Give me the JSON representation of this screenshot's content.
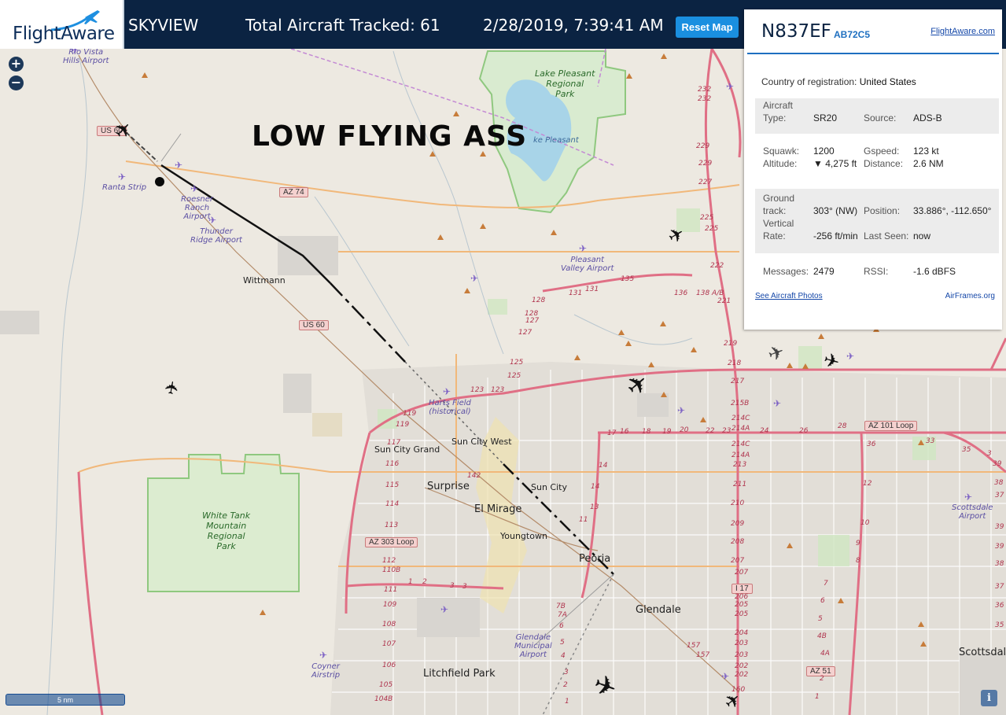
{
  "header": {
    "logo_text": "FlightAware",
    "app_name": "SKYVIEW",
    "aircraft_tracked": "Total Aircraft Tracked: 61",
    "datetime": "2/28/2019, 7:39:41 AM",
    "reset_label": "Reset Map"
  },
  "map": {
    "overlay_text": "LOW FLYING ASS",
    "scale_label": "5 nm",
    "zoom_in": "+",
    "zoom_out": "−",
    "info_label": "i",
    "places": {
      "rio_vista_1": "Rio Vista",
      "rio_vista_2": "Hills Airport",
      "lake_pleasant_1": "Lake Pleasant",
      "lake_pleasant_2": "Regional",
      "lake_pleasant_3": "Park",
      "lake_pleasant_small": "ke Pleasant",
      "ranta": "Ranta Strip",
      "roesner_1": "Roesner",
      "roesner_2": "Ranch",
      "roesner_3": "Airport",
      "thunder_1": "Thunder",
      "thunder_2": "Ridge Airport",
      "wittmann": "Wittmann",
      "pleasant_valley_1": "Pleasant",
      "pleasant_valley_2": "Valley Airport",
      "harts_1": "Harts Field",
      "harts_2": "(historical)",
      "sun_city_grand": "Sun City Grand",
      "sun_city_west": "Sun City West",
      "surprise": "Surprise",
      "sun_city": "Sun City",
      "el_mirage": "El Mirage",
      "youngtown": "Youngtown",
      "peoria": "Peoria",
      "glendale": "Glendale",
      "glendale_muni_1": "Glendale",
      "glendale_muni_2": "Municipal",
      "glendale_muni_3": "Airport",
      "litchfield": "Litchfield Park",
      "coyner_1": "Coyner",
      "coyner_2": "Airstrip",
      "white_tank_1": "White Tank",
      "white_tank_2": "Mountain",
      "white_tank_3": "Regional",
      "white_tank_4": "Park",
      "scottsdale_airport_1": "Scottsdale",
      "scottsdale_airport_2": "Airport",
      "scottsdale": "Scottsdal"
    },
    "shields": {
      "us60_top": "US 60",
      "us60_mid": "US 60",
      "az74": "AZ 74",
      "az101": "AZ 101 Loop",
      "az303": "AZ 303 Loop",
      "i17": "I 17",
      "az51": "AZ 51"
    },
    "exits": [
      "232",
      "232",
      "229",
      "229",
      "227",
      "225",
      "225",
      "222",
      "221",
      "219",
      "218",
      "217",
      "215B",
      "214C",
      "214A",
      "214C",
      "214A",
      "213",
      "211",
      "210",
      "209",
      "208",
      "207",
      "207",
      "206",
      "205",
      "205",
      "204",
      "203",
      "203",
      "202",
      "202",
      "160",
      "131",
      "131",
      "135",
      "136",
      "138 A/B",
      "128",
      "128",
      "127",
      "127",
      "125",
      "125",
      "123",
      "123",
      "119",
      "119",
      "117",
      "116",
      "115",
      "114",
      "113",
      "112",
      "110B",
      "111",
      "109",
      "108",
      "107",
      "106",
      "105",
      "104B",
      "17",
      "16",
      "18",
      "19",
      "20",
      "22",
      "23",
      "24",
      "26",
      "28",
      "33",
      "35",
      "36",
      "14",
      "14",
      "13",
      "12",
      "11",
      "10",
      "9",
      "8",
      "7",
      "6",
      "5",
      "4B",
      "4A",
      "2",
      "1",
      "1",
      "2",
      "3",
      "3",
      "142",
      "157",
      "157",
      "7B",
      "7A",
      "6",
      "5",
      "4",
      "3",
      "2",
      "1",
      "3",
      "39",
      "38",
      "37",
      "39",
      "39",
      "38",
      "37",
      "36",
      "35",
      "34"
    ]
  },
  "panel": {
    "registration": "N837EF",
    "hex": "AB72C5",
    "fa_link": "FlightAware.com",
    "country_label": "Country of registration:",
    "country_value": "United States",
    "aircraft_label_1": "Aircraft",
    "aircraft_label_2": "Type:",
    "aircraft_value": "SR20",
    "source_label": "Source:",
    "source_value": "ADS-B",
    "squawk_label": "Squawk:",
    "squawk_value": "1200",
    "gspeed_label": "Gspeed:",
    "gspeed_value": "123 kt",
    "altitude_label": "Altitude:",
    "altitude_value": "▼ 4,275 ft",
    "distance_label": "Distance:",
    "distance_value": "2.6 NM",
    "ground_label_1": "Ground",
    "ground_label_2": "track:",
    "ground_value": "303° (NW)",
    "position_label": "Position:",
    "position_value": "33.886°, -112.650°",
    "vrate_label_1": "Vertical",
    "vrate_label_2": "Rate:",
    "vrate_value": "-256 ft/min",
    "lastseen_label": "Last Seen:",
    "lastseen_value": "now",
    "messages_label": "Messages:",
    "messages_value": "2479",
    "rssi_label": "RSSI:",
    "rssi_value": "-1.6 dBFS",
    "photos_link": "See Aircraft Photos",
    "airframes_link": "AirFrames.org"
  },
  "colors": {
    "header_bg": "#0b2342",
    "reset_button": "#1a8fe0",
    "accent": "#1e6fc0",
    "highway": "#e06f85",
    "arterial": "#f1b87a",
    "park_border": "#8fc87f",
    "lake": "#a8d4e8",
    "airport_icon": "#7a5ec4"
  },
  "icons": [
    "plus-icon",
    "minus-icon",
    "airplane-icon",
    "airport-icon",
    "peak-icon",
    "info-icon",
    "logo-plane-icon"
  ]
}
